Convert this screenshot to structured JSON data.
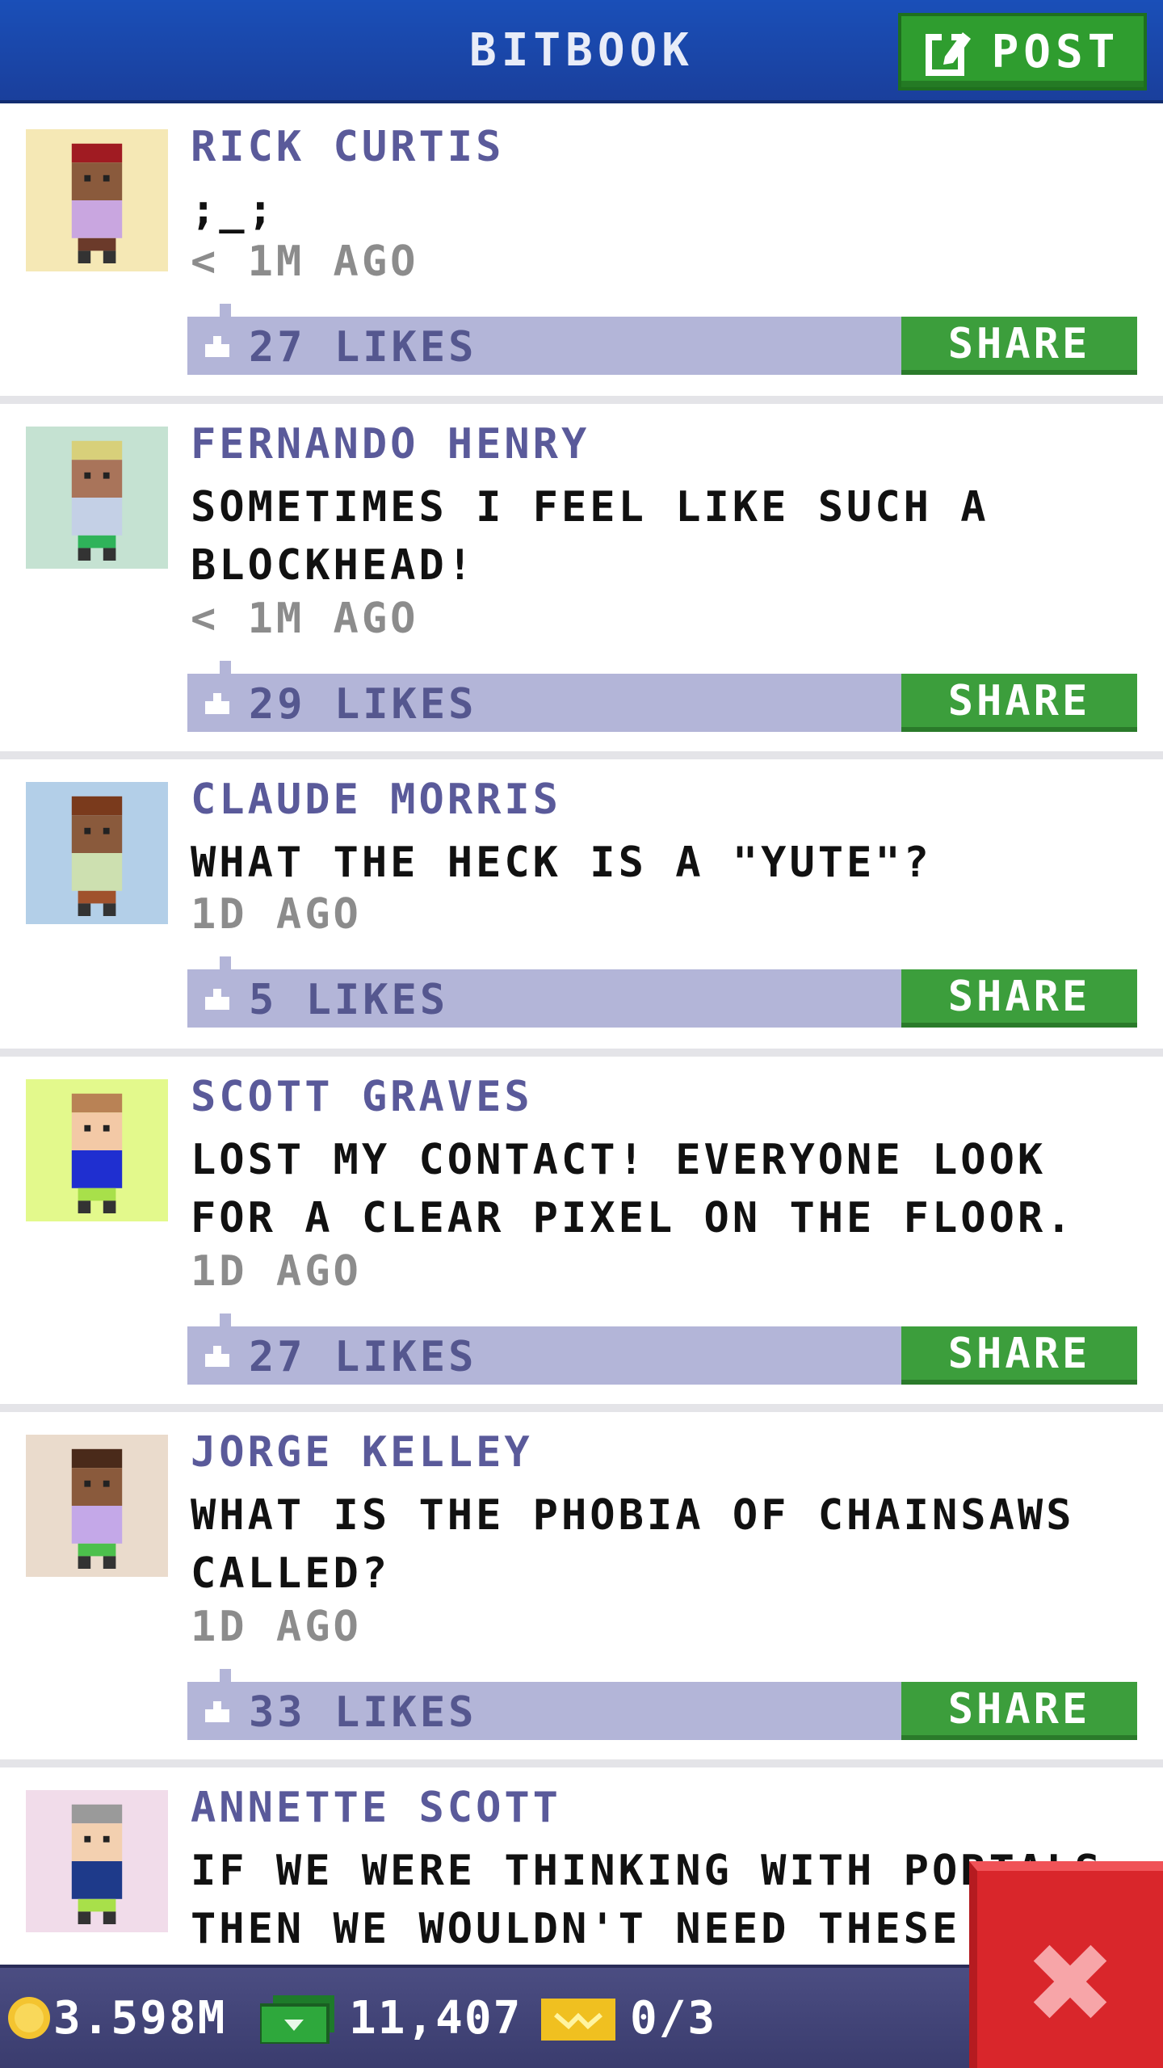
{
  "header": {
    "title": "BITBOOK",
    "post_label": "POST"
  },
  "posts": [
    {
      "name": "RICK CURTIS",
      "message": ";_;",
      "time": "< 1M AGO",
      "likes": "27 LIKES",
      "share": "SHARE",
      "avatar_bg": "#f5e8b5",
      "skin": "#8a5a3c",
      "hair": "#a01b22",
      "shirt": "#c9a6e0",
      "pants": "#6b3a2a"
    },
    {
      "name": "FERNANDO HENRY",
      "message": "SOMETIMES I FEEL LIKE SUCH A BLOCKHEAD!",
      "time": "< 1M AGO",
      "likes": "29 LIKES",
      "share": "SHARE",
      "avatar_bg": "#c5e2d2",
      "skin": "#a9745a",
      "hair": "#d8d07a",
      "shirt": "#c4d0e6",
      "pants": "#2fb35a"
    },
    {
      "name": "CLAUDE MORRIS",
      "message": "WHAT THE HECK IS A \"YUTE\"?",
      "time": "1D AGO",
      "likes": "5 LIKES",
      "share": "SHARE",
      "avatar_bg": "#b3cfe8",
      "skin": "#8a5a3c",
      "hair": "#7a3a1c",
      "shirt": "#cde0b0",
      "pants": "#a0522d"
    },
    {
      "name": "SCOTT GRAVES",
      "message": "LOST MY CONTACT! EVERYONE LOOK FOR A CLEAR PIXEL ON THE FLOOR.",
      "time": "1D AGO",
      "likes": "27 LIKES",
      "share": "SHARE",
      "avatar_bg": "#e3f98c",
      "skin": "#f3c9a6",
      "hair": "#b98255",
      "shirt": "#1f2fd0",
      "pants": "#a8e04a"
    },
    {
      "name": "JORGE KELLEY",
      "message": "WHAT IS THE PHOBIA OF CHAINSAWS CALLED?",
      "time": "1D AGO",
      "likes": "33 LIKES",
      "share": "SHARE",
      "avatar_bg": "#eadbcc",
      "skin": "#8a5a3c",
      "hair": "#4a2a1a",
      "shirt": "#c4a8e8",
      "pants": "#4cc04c"
    },
    {
      "name": "ANNETTE SCOTT",
      "message": "IF WE WERE THINKING WITH PORTALS THEN WE WOULDN'T NEED THESE",
      "time": "",
      "likes": "",
      "share": "",
      "avatar_bg": "#f1dcea",
      "skin": "#f3d0b0",
      "hair": "#9a9a9a",
      "shirt": "#1e3a8a",
      "pants": "#a8e04a"
    }
  ],
  "status": {
    "coins": "3.598M",
    "cash": "11,407",
    "tickets": "0/3"
  },
  "colors": {
    "header": "#1a4fb8",
    "accent_green": "#3c9e3c",
    "likes_bar": "#b3b5d8",
    "name_text": "#5a5a9a",
    "close_red": "#d9262b"
  },
  "icons": {
    "post": "edit-icon",
    "thumb": "thumbs-up-icon",
    "coin": "coin-icon",
    "cash": "cash-icon",
    "ticket": "ticket-icon",
    "close": "close-icon"
  }
}
